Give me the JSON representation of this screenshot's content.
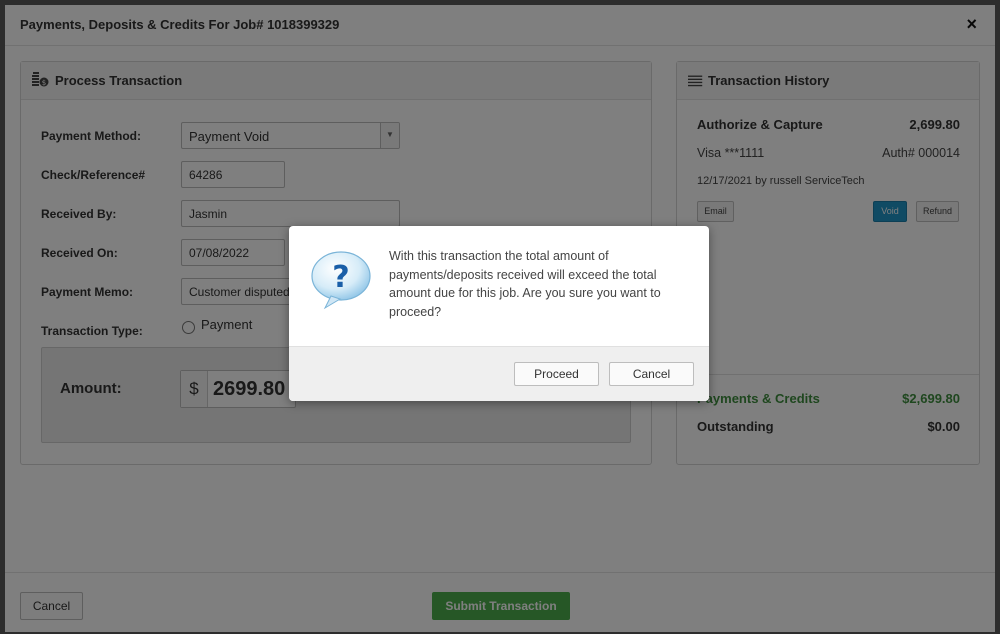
{
  "modal": {
    "title": "Payments, Deposits & Credits For Job# 1018399329",
    "close_label": "×"
  },
  "process": {
    "title": "Process Transaction",
    "fields": {
      "payment_method": {
        "label": "Payment Method:",
        "value": "Payment Void"
      },
      "check_ref": {
        "label": "Check/Reference#",
        "value": "64286"
      },
      "received_by": {
        "label": "Received By:",
        "value": "Jasmin"
      },
      "received_on": {
        "label": "Received On:",
        "value": "07/08/2022"
      },
      "payment_memo": {
        "label": "Payment Memo:",
        "value": "Customer disputed"
      },
      "transaction_type": {
        "label": "Transaction Type:",
        "option": "Payment"
      }
    },
    "amount": {
      "label": "Amount:",
      "currency": "$",
      "value": "2699.80"
    }
  },
  "history": {
    "title": "Transaction History",
    "entry": {
      "type": "Authorize & Capture",
      "amount": "2,699.80",
      "card": "Visa ***1111",
      "auth": "Auth# 000014",
      "date_by": "12/17/2021 by russell ServiceTech",
      "buttons": {
        "email": "Email",
        "void": "Void",
        "refund": "Refund"
      }
    },
    "totals": {
      "payments_label": "Payments & Credits",
      "payments_value": "$2,699.80",
      "outstanding_label": "Outstanding",
      "outstanding_value": "$0.00"
    }
  },
  "footer": {
    "cancel_label": "Cancel",
    "submit_label": "Submit Transaction"
  },
  "dialog": {
    "message": "With this transaction the total amount of payments/deposits received will exceed the total amount due for this job. Are you sure you want to proceed?",
    "proceed_label": "Proceed",
    "cancel_label": "Cancel",
    "icon": "question-bubble-icon"
  },
  "colors": {
    "green": "#3f8f3f",
    "void_blue": "#2196c9",
    "submit_green": "#4cae4c"
  }
}
